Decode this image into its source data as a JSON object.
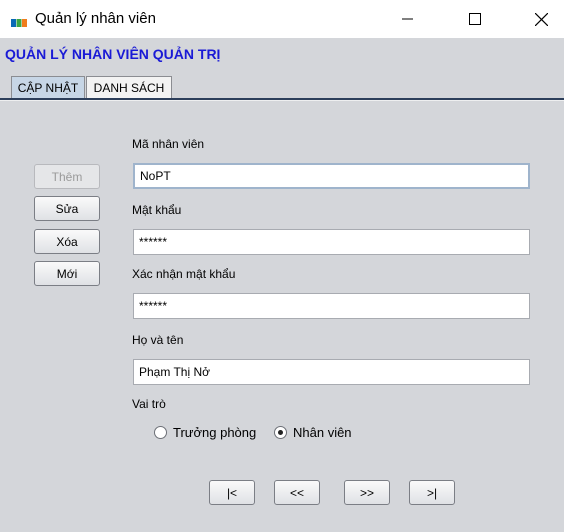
{
  "window": {
    "title": "Quản lý nhân viên",
    "minimize_symbol": "—",
    "maximize_symbol": "☐",
    "close_symbol": "✕"
  },
  "heading": "QUẢN LÝ NHÂN VIÊN QUẢN TRỊ",
  "tabs": [
    {
      "label": "CẬP NHẬT",
      "active": true
    },
    {
      "label": "DANH SÁCH",
      "active": false
    }
  ],
  "actions": {
    "add": "Thêm",
    "edit": "Sửa",
    "delete": "Xóa",
    "new": "Mới"
  },
  "form": {
    "employee_id": {
      "label": "Mã nhân viên",
      "value": "NoPT"
    },
    "password": {
      "label": "Mật khẩu",
      "value": "******"
    },
    "confirm_password": {
      "label": "Xác nhận mật khẩu",
      "value": "******"
    },
    "full_name": {
      "label": "Họ và tên",
      "value": "Phạm Thị Nở"
    },
    "role": {
      "label": "Vai trò",
      "options": [
        "Trưởng phòng",
        "Nhân viên"
      ],
      "selected": "Nhân viên"
    }
  },
  "navigation": {
    "first": "|<",
    "prev": "<<",
    "next": ">>",
    "last": ">|"
  },
  "colors": {
    "heading": "#1a1ad6",
    "background": "#d4d6da",
    "active_tab": "#c7d6e6"
  }
}
